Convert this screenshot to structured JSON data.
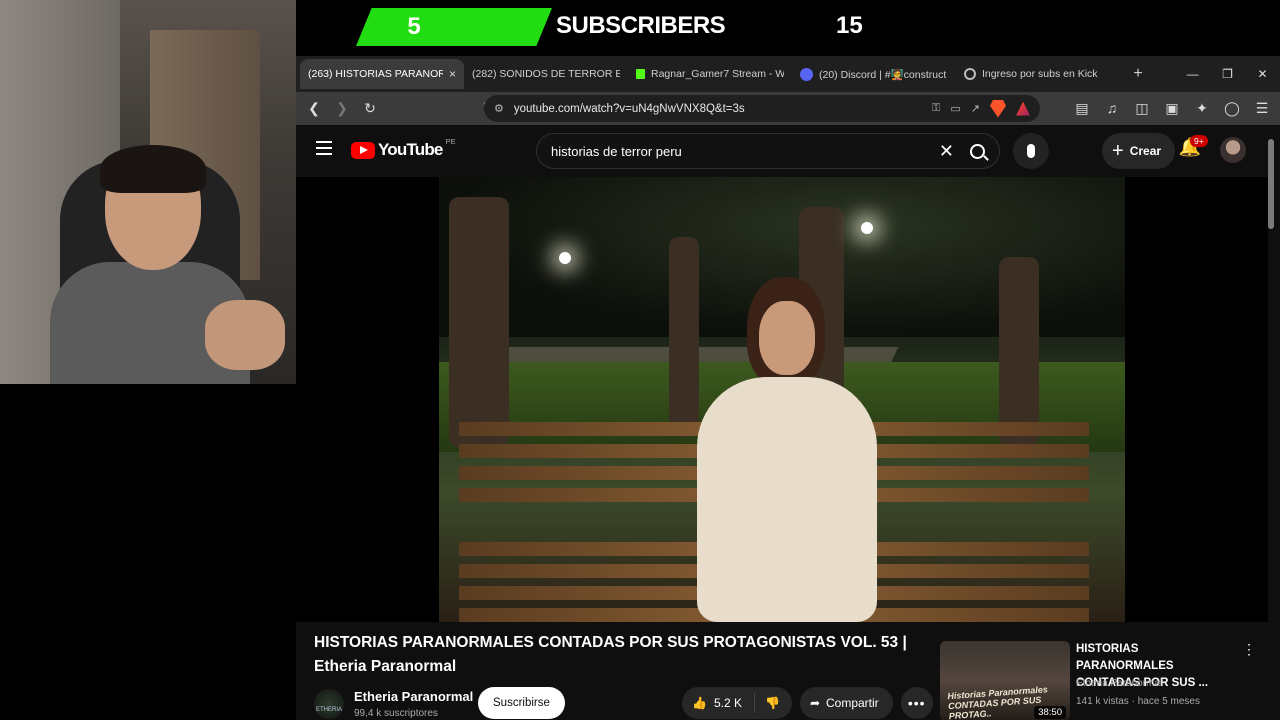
{
  "overlay": {
    "sub_count": "5",
    "sub_label": "SUBSCRIBERS",
    "sub_goal": "15"
  },
  "browser": {
    "tabs": [
      {
        "label": "(263) HISTORIAS PARANOR",
        "icon": "youtube-icon",
        "active": true
      },
      {
        "label": "(282) SONIDOS DE TERROR EN",
        "icon": "youtube-icon"
      },
      {
        "label": "Ragnar_Gamer7 Stream - Watc",
        "icon": "kick-icon"
      },
      {
        "label": "(20) Discord | #🧑‍🏫construct",
        "icon": "discord-icon"
      },
      {
        "label": "Ingreso por subs en Kick",
        "icon": "globe-icon"
      }
    ],
    "close_tab": "×",
    "new_tab": "+",
    "url": "youtube.com/watch?v=uN4gNwVNX8Q&t=3s",
    "colors": {
      "accent": "#ff0033",
      "kick": "#53fc18",
      "discord": "#5865f2"
    }
  },
  "youtube": {
    "logo_text": "YouTube",
    "country_code": "PE",
    "search_query": "historias de terror peru",
    "create_label": "Crear",
    "notif_badge": "9+",
    "video": {
      "title": "HISTORIAS PARANORMALES CONTADAS POR SUS PROTAGONISTAS VOL. 53 | Etheria Paranormal",
      "channel": "Etheria Paranormal",
      "subscribers": "99,4 k suscriptores",
      "subscribe_label": "Suscribirse",
      "likes": "5.2 K",
      "share_label": "Compartir"
    },
    "recommended": {
      "title": "HISTORIAS PARANORMALES CONTADAS POR SUS ...",
      "channel": "Etheria Paranormal",
      "meta": "141 k vistas · hace 5 meses",
      "duration": "38:50",
      "thumb_text": "Historias Paranormales CONTADAS POR SUS PROTAG.."
    },
    "channel_avatar_text": "ETHERIA"
  }
}
